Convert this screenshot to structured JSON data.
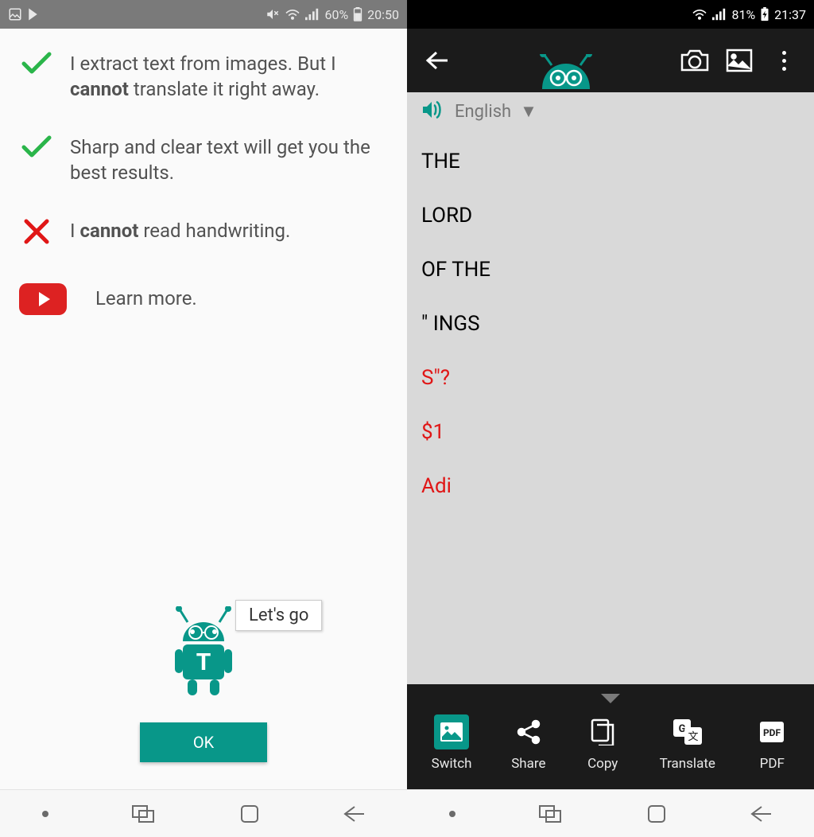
{
  "left": {
    "status": {
      "battery": "60%",
      "time": "20:50"
    },
    "intro": {
      "line1_pre": "I extract text from images. But I ",
      "line1_bold": "cannot",
      "line1_post": " translate it right away.",
      "line2": "Sharp and clear text will get you the best results.",
      "line3_pre": "I ",
      "line3_bold": "cannot",
      "line3_post": " read handwriting.",
      "learn_more": "Learn more."
    },
    "speech": "Let's go",
    "ok": "OK"
  },
  "right": {
    "status": {
      "battery": "81%",
      "time": "21:37"
    },
    "language": "English",
    "ocr_lines": [
      {
        "text": "THE",
        "color": "black"
      },
      {
        "text": "LORD",
        "color": "black"
      },
      {
        "text": "OF THE",
        "color": "black"
      },
      {
        "text": "\" INGS",
        "color": "black"
      },
      {
        "text": "S\"?",
        "color": "red"
      },
      {
        "text": "$1",
        "color": "red"
      },
      {
        "text": "Adi",
        "color": "red"
      }
    ],
    "actions": {
      "switch": "Switch",
      "share": "Share",
      "copy": "Copy",
      "translate": "Translate",
      "pdf": "PDF"
    }
  },
  "colors": {
    "accent": "#089789",
    "red": "#e01616"
  }
}
